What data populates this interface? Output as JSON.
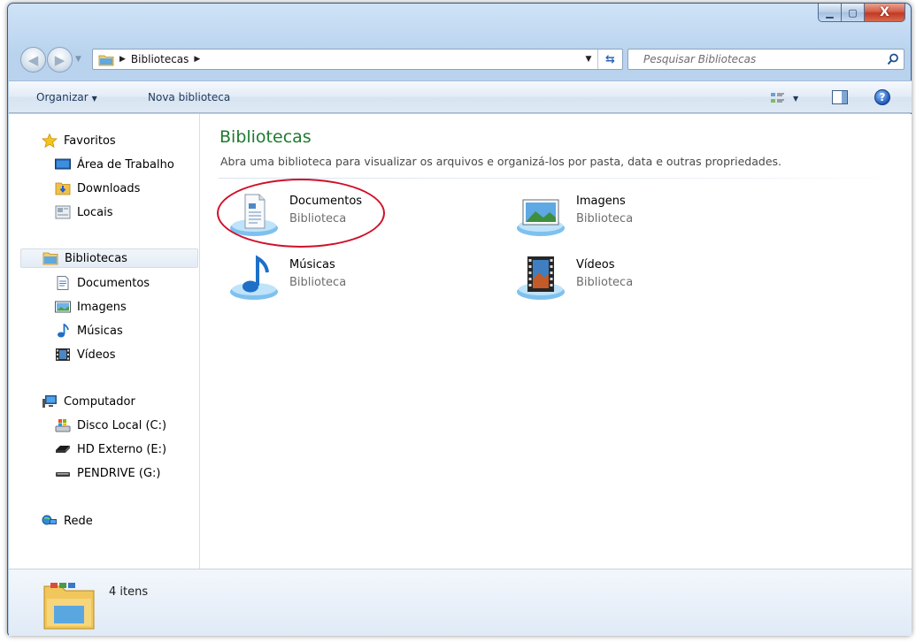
{
  "window": {
    "minimize_label": "▁",
    "maximize_label": "▢",
    "close_label": "X"
  },
  "address": {
    "crumb": "Bibliotecas"
  },
  "search": {
    "placeholder": "Pesquisar Bibliotecas"
  },
  "toolbar": {
    "organize_label": "Organizar",
    "new_library_label": "Nova biblioteca",
    "help_label": "?"
  },
  "nav": {
    "favorites": {
      "label": "Favoritos",
      "items": [
        "Área de Trabalho",
        "Downloads",
        "Locais"
      ]
    },
    "libraries": {
      "label": "Bibliotecas",
      "items": [
        "Documentos",
        "Imagens",
        "Músicas",
        "Vídeos"
      ]
    },
    "computer": {
      "label": "Computador",
      "items": [
        "Disco Local (C:)",
        "HD Externo (E:)",
        "PENDRIVE (G:)"
      ]
    },
    "network": {
      "label": "Rede"
    }
  },
  "content": {
    "title": "Bibliotecas",
    "description": "Abra uma biblioteca para visualizar os arquivos e organizá-los por pasta, data e outras propriedades.",
    "libraries": [
      {
        "name": "Documentos",
        "type": "Biblioteca",
        "icon": "documents-library-icon"
      },
      {
        "name": "Imagens",
        "type": "Biblioteca",
        "icon": "pictures-library-icon"
      },
      {
        "name": "Músicas",
        "type": "Biblioteca",
        "icon": "music-library-icon"
      },
      {
        "name": "Vídeos",
        "type": "Biblioteca",
        "icon": "videos-library-icon"
      }
    ]
  },
  "status": {
    "count_text": "4 itens"
  },
  "colors": {
    "title_green": "#1e7a2f",
    "highlight_red": "#d0102a",
    "window_frame": "#b9d3ee"
  }
}
